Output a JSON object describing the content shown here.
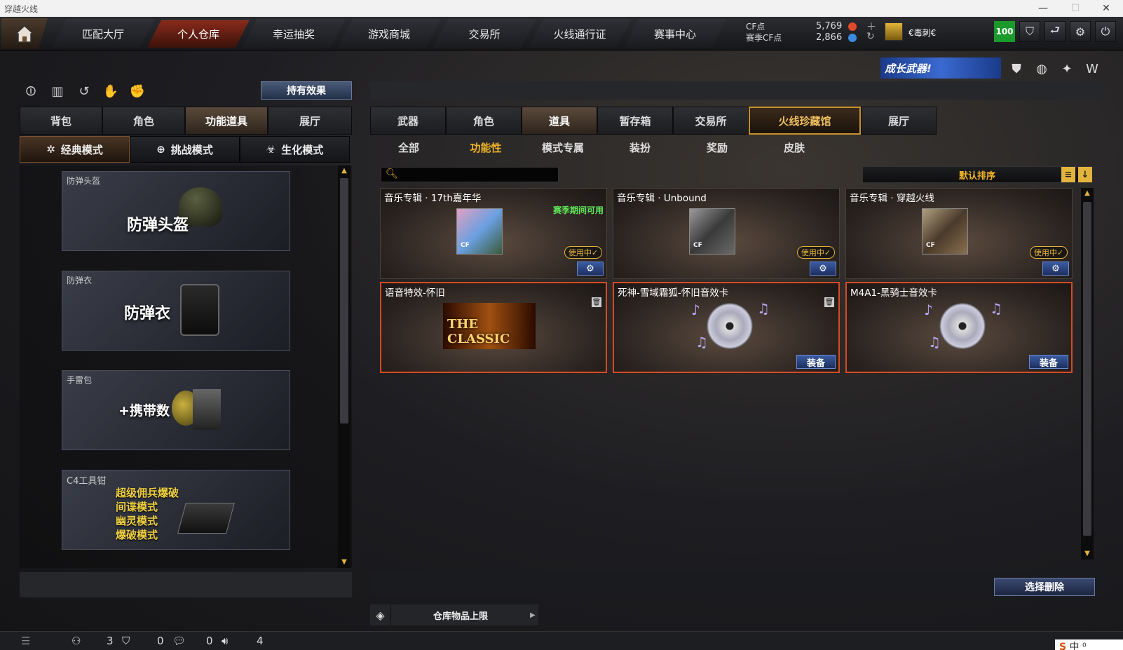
{
  "window": {
    "title": "穿越火线",
    "controls": [
      "—",
      "☐",
      "✕"
    ]
  },
  "topnav": {
    "tabs": [
      "匹配大厅",
      "个人仓库",
      "幸运抽奖",
      "游戏商城",
      "交易所",
      "火线通行证",
      "赛事中心"
    ],
    "active_tab": "个人仓库",
    "cf_label": "CF点",
    "season_cf_label": "赛季CF点",
    "cf_value": "5,769",
    "season_cf_value": "2,866",
    "player_name": "€毒刺€",
    "level": "100"
  },
  "left": {
    "effect_button": "持有效果",
    "tabs": [
      "背包",
      "角色",
      "功能道具",
      "展厅"
    ],
    "active_tab": "功能道具",
    "modes": [
      "经典模式",
      "挑战模式",
      "生化模式"
    ],
    "active_mode": "经典模式",
    "items": [
      {
        "caption": "防弹头盔",
        "big": "防弹头盔"
      },
      {
        "caption": "防弹衣",
        "big": "防弹衣"
      },
      {
        "caption": "手雷包",
        "big": "+携带数"
      },
      {
        "caption": "C4工具钳",
        "lines": [
          "超级佣兵爆破",
          "间谍模式",
          "幽灵模式",
          "爆破模式"
        ]
      }
    ]
  },
  "right": {
    "banner": "成长武器!",
    "tabs": [
      "武器",
      "角色",
      "道具",
      "暂存箱",
      "交易所",
      "火线珍藏馆",
      "展厅"
    ],
    "active_tab": "火线珍藏馆",
    "subtabs": [
      "全部",
      "功能性",
      "模式专属",
      "装扮",
      "奖励",
      "皮肤"
    ],
    "active_subtab": "功能性",
    "search_placeholder": "",
    "sort_label": "默认排序",
    "cards": [
      {
        "title": "音乐专辑 · 17th嘉年华",
        "season": "赛季期间可用",
        "inuse": "使用中✓"
      },
      {
        "title": "音乐专辑 · Unbound",
        "inuse": "使用中✓"
      },
      {
        "title": "音乐专辑 · 穿越火线",
        "inuse": "使用中✓"
      },
      {
        "title": "语音特效-怀旧",
        "art": "THE CLASSIC"
      },
      {
        "title": "死神-雪域霜狐-怀旧音效卡",
        "equip": "装备"
      },
      {
        "title": "M4A1-黑骑士音效卡",
        "equip": "装备"
      }
    ],
    "delete_button": "选择删除",
    "storage_label": "仓库物品上限"
  },
  "statusbar": {
    "values": [
      "3",
      "0",
      "0",
      "4"
    ]
  },
  "ime": {
    "text": "中 ⁰"
  }
}
